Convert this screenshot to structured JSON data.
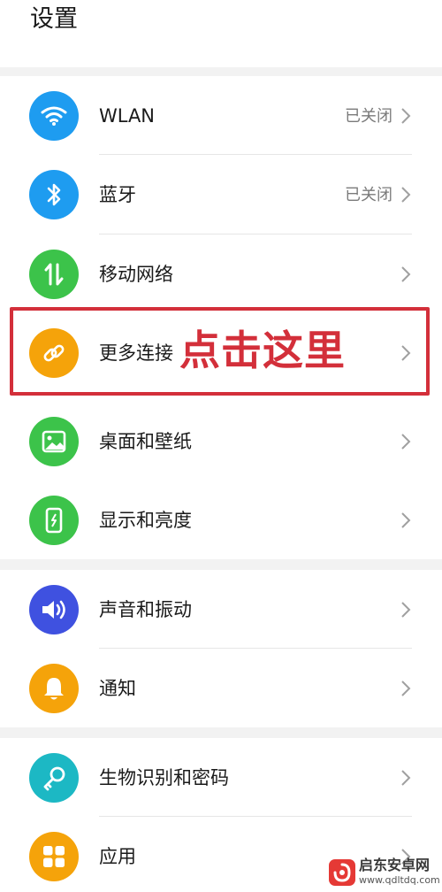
{
  "header": {
    "title": "设置"
  },
  "sections": [
    {
      "items": [
        {
          "id": "wlan",
          "label": "WLAN",
          "value": "已关闭",
          "icon": "wifi-icon",
          "color": "#1e9cf0"
        },
        {
          "id": "bluetooth",
          "label": "蓝牙",
          "value": "已关闭",
          "icon": "bluetooth-icon",
          "color": "#1e9cf0"
        },
        {
          "id": "mobile-network",
          "label": "移动网络",
          "value": "",
          "icon": "mobile-data-icon",
          "color": "#3cc34a"
        },
        {
          "id": "more-connections",
          "label": "更多连接",
          "value": "",
          "icon": "link-icon",
          "color": "#f5a30a"
        },
        {
          "id": "wallpaper",
          "label": "桌面和壁纸",
          "value": "",
          "icon": "image-icon",
          "color": "#3cc34a"
        },
        {
          "id": "display",
          "label": "显示和亮度",
          "value": "",
          "icon": "display-icon",
          "color": "#3cc34a"
        }
      ]
    },
    {
      "items": [
        {
          "id": "sound",
          "label": "声音和振动",
          "value": "",
          "icon": "volume-icon",
          "color": "#3f51e0"
        },
        {
          "id": "notifications",
          "label": "通知",
          "value": "",
          "icon": "bell-icon",
          "color": "#f5a30a"
        }
      ]
    },
    {
      "items": [
        {
          "id": "biometrics",
          "label": "生物识别和密码",
          "value": "",
          "icon": "key-icon",
          "color": "#1cb8c4"
        },
        {
          "id": "apps",
          "label": "应用",
          "value": "",
          "icon": "apps-grid-icon",
          "color": "#f5a30a"
        }
      ]
    }
  ],
  "annotation": {
    "text": "点击这里",
    "color": "#d32f3a"
  },
  "watermark": {
    "name": "启东安卓网",
    "url": "www.qdltdq.com"
  }
}
